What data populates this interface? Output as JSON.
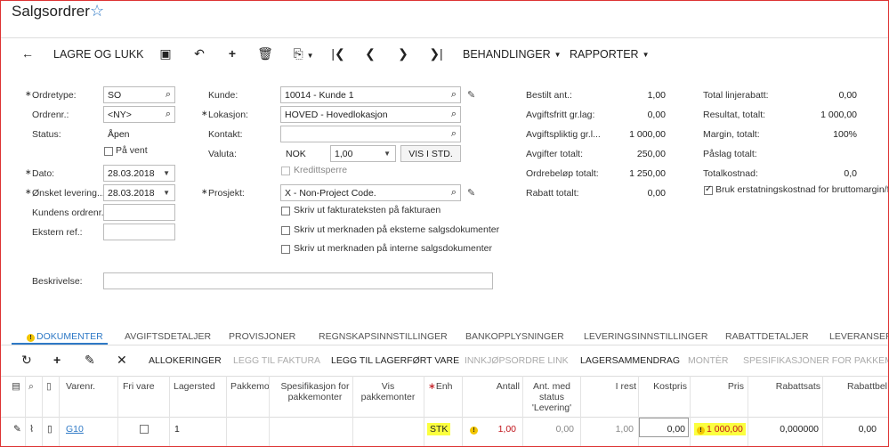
{
  "page": {
    "title": "Salgsordrer"
  },
  "toolbar": {
    "save_close": "LAGRE OG LUKK",
    "processing": "BEHANDLINGER",
    "reports": "RAPPORTER"
  },
  "form": {
    "order_type": {
      "label": "Ordretype:",
      "value": "SO"
    },
    "order_nbr": {
      "label": "Ordrenr.:",
      "value": "<NY>"
    },
    "status": {
      "label": "Status:",
      "value": "Åpen"
    },
    "on_hold": {
      "label": "På vent",
      "checked": false
    },
    "date": {
      "label": "Dato:",
      "value": "28.03.2018"
    },
    "requested": {
      "label": "Ønsket levering...",
      "value": "28.03.2018"
    },
    "cust_order": {
      "label": "Kundens ordrenr.:",
      "value": ""
    },
    "ext_ref": {
      "label": "Ekstern ref.:",
      "value": ""
    },
    "customer": {
      "label": "Kunde:",
      "value": "10014 - Kunde 1"
    },
    "location": {
      "label": "Lokasjon:",
      "value": "HOVED - Hovedlokasjon"
    },
    "contact": {
      "label": "Kontakt:",
      "value": ""
    },
    "currency": {
      "label": "Valuta:",
      "code": "NOK",
      "rate": "1,00",
      "button": "VIS I STD."
    },
    "credit_hold": {
      "label": "Kredittsperre"
    },
    "project": {
      "label": "Prosjekt:",
      "value": "X - Non-Project Code."
    },
    "print_invoice": {
      "label": "Skriv ut fakturateksten på fakturaen"
    },
    "print_ext": {
      "label": "Skriv ut merknaden på eksterne salgsdokumenter"
    },
    "print_int": {
      "label": "Skriv ut merknaden på interne salgsdokumenter"
    },
    "description": {
      "label": "Beskrivelse:",
      "value": ""
    }
  },
  "summary_mid": [
    {
      "label": "Bestilt ant.:",
      "value": "1,00"
    },
    {
      "label": "Avgiftsfritt gr.lag:",
      "value": "0,00"
    },
    {
      "label": "Avgiftspliktig gr.l...",
      "value": "1 000,00"
    },
    {
      "label": "Avgifter totalt:",
      "value": "250,00"
    },
    {
      "label": "Ordrebeløp totalt:",
      "value": "1 250,00"
    },
    {
      "label": "Rabatt totalt:",
      "value": "0,00"
    }
  ],
  "summary_right": [
    {
      "label": "Total linjerabatt:",
      "value": "0,00"
    },
    {
      "label": "Resultat, totalt:",
      "value": "1 000,00"
    },
    {
      "label": "Margin, totalt:",
      "value": "100%"
    },
    {
      "label": "Påslag totalt:",
      "value": ""
    },
    {
      "label": "Totalkostnad:",
      "value": "0,0"
    }
  ],
  "replacement_cost": {
    "label": "Bruk erstatningskostnad for bruttomargin/for",
    "checked": true
  },
  "tabs": [
    "DOKUMENTER",
    "AVGIFTSDETALJER",
    "PROVISJONER",
    "REGNSKAPSINNSTILLINGER",
    "BANKOPPLYSNINGER",
    "LEVERINGSINNSTILLINGER",
    "RABATTDETALJER",
    "LEVERANSER"
  ],
  "grid_toolbar": {
    "allocations": "ALLOKERINGER",
    "add_invoice": "LEGG TIL FAKTURA",
    "add_stock": "LEGG TIL LAGERFØRT VARE",
    "po_link": "INNKJØPSORDRE LINK",
    "inv_summary": "LAGERSAMMENDRAG",
    "assemble": "MONTÈR",
    "kit_spec": "SPESIFIKASJONER FOR PAKKEMO"
  },
  "columns": {
    "item": "Varenr.",
    "free": "Fri vare",
    "warehouse": "Lagersted",
    "kit": "Pakkemo",
    "kit_spec": "Spesifikasjon for pakkemonter",
    "show_kit": "Vis pakkemonter",
    "uom": "Enh",
    "qty": "Antall",
    "qty_ship": "Ant. med status 'Levering'",
    "open": "I rest",
    "cost": "Kostpris",
    "price": "Pris",
    "disc_pct": "Rabattsats",
    "disc_amt": "Rabattbel"
  },
  "row": {
    "item": "G10",
    "warehouse": "1",
    "uom": "STK",
    "qty": "1,00",
    "qty_ship": "0,00",
    "open": "1,00",
    "cost": "0,00",
    "price": "1 000,00",
    "disc_pct": "0,000000",
    "disc_amt": "0,00"
  },
  "colors": {
    "accent": "#2e79c6",
    "highlight": "#fbff3f",
    "error": "#c0141b"
  }
}
